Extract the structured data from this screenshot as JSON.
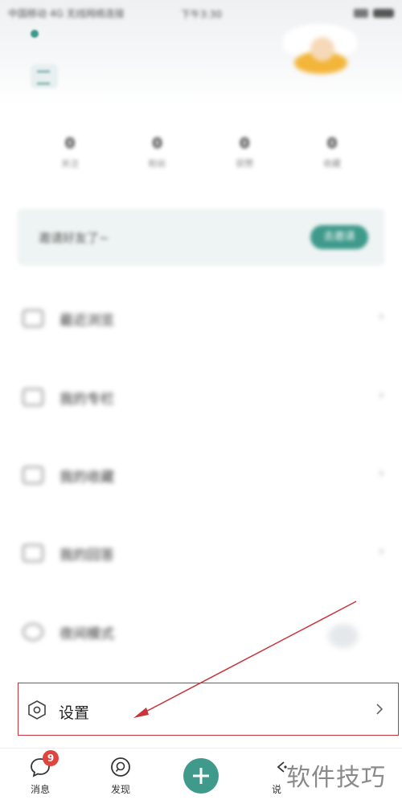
{
  "status_bar": {
    "left_text": "中国移动 4G 无线网络连接",
    "center_text": "下午3:30"
  },
  "stats": [
    {
      "value": "0",
      "label": "关注"
    },
    {
      "value": "0",
      "label": "粉丝"
    },
    {
      "value": "0",
      "label": "获赞"
    },
    {
      "value": "0",
      "label": "收藏"
    }
  ],
  "invite": {
    "text": "邀请好友了~",
    "button_label": "去邀请"
  },
  "menu": {
    "items": [
      {
        "label": "最近浏览"
      },
      {
        "label": "我的专栏"
      },
      {
        "label": "我的收藏"
      },
      {
        "label": "我的回答"
      },
      {
        "label": "夜间模式"
      }
    ]
  },
  "settings": {
    "label": "设置",
    "icon": "hexagon-settings-icon"
  },
  "bottom_nav": {
    "messages_label": "消息",
    "messages_badge": "9",
    "discover_label": "发现",
    "add_icon": "plus-icon",
    "fourth_label": "说"
  },
  "watermark": "软件技巧",
  "colors": {
    "accent": "#3f9a8c",
    "highlight_border": "#c8343a",
    "badge": "#e0453d"
  }
}
